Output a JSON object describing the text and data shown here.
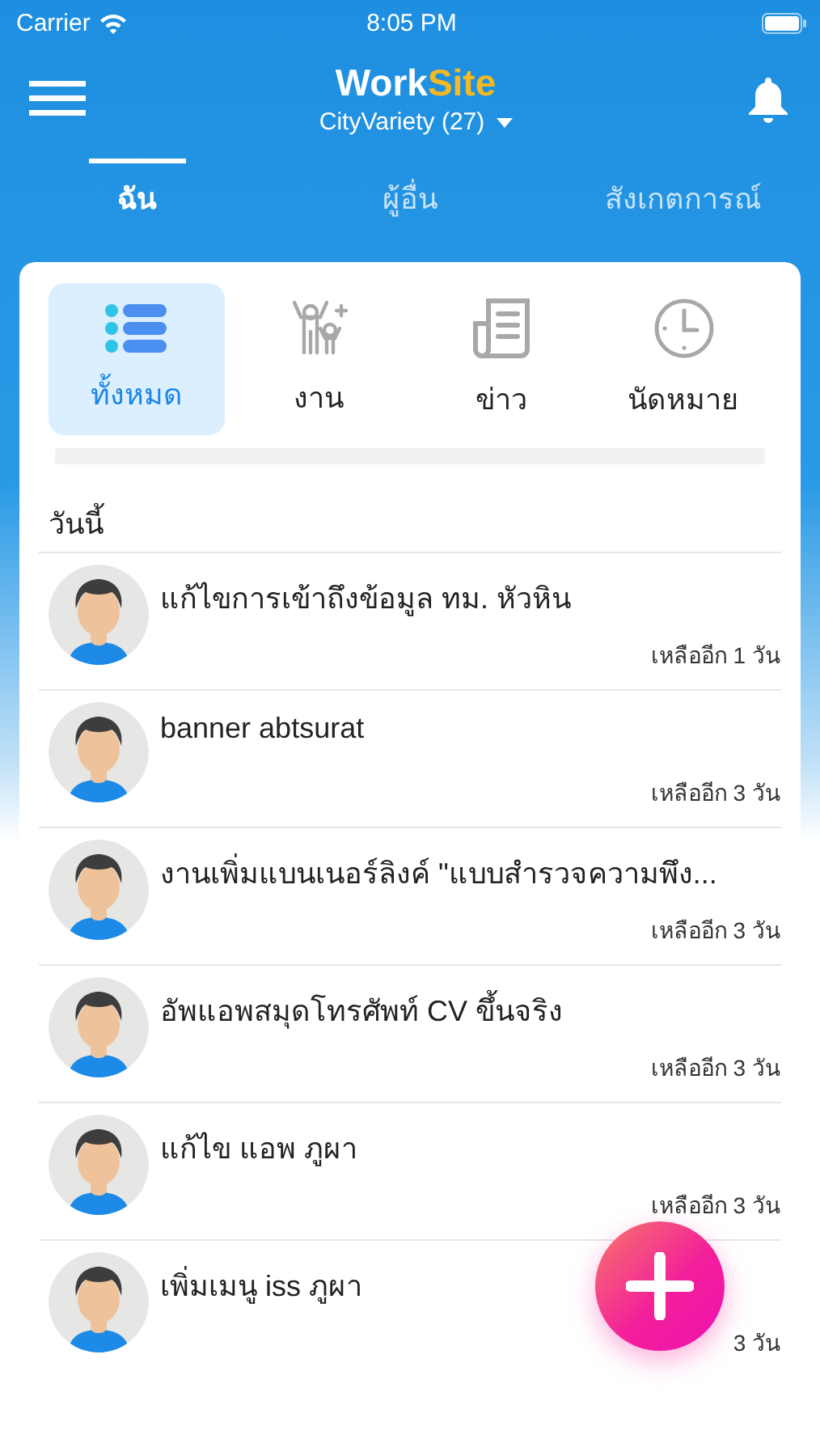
{
  "status_bar": {
    "carrier": "Carrier",
    "time": "8:05 PM"
  },
  "header": {
    "title_part1": "Work",
    "title_part2": "Site",
    "subtitle": "CityVariety (27)"
  },
  "tabs": [
    {
      "label": "ฉัน",
      "selected": true
    },
    {
      "label": "ผู้อื่น",
      "selected": false
    },
    {
      "label": "สังเกตการณ์",
      "selected": false
    }
  ],
  "categories": [
    {
      "label": "ทั้งหมด",
      "kind": "list",
      "selected": true
    },
    {
      "label": "งาน",
      "kind": "people",
      "selected": false
    },
    {
      "label": "ข่าว",
      "kind": "news",
      "selected": false
    },
    {
      "label": "นัดหมาย",
      "kind": "clock",
      "selected": false
    }
  ],
  "section_title": "วันนี้",
  "items": [
    {
      "title": "แก้ไขการเข้าถึงข้อมูล ทม. หัวหิน",
      "due": "เหลืออีก 1 วัน"
    },
    {
      "title": "banner abtsurat",
      "due": "เหลืออีก 3 วัน"
    },
    {
      "title": "งานเพิ่มแบนเนอร์ลิงค์ \"แบบสำรวจความพึง...",
      "due": "เหลืออีก 3 วัน"
    },
    {
      "title": "อัพแอพสมุดโทรศัพท์ CV ขึ้นจริง",
      "due": "เหลืออีก 3 วัน"
    },
    {
      "title": "แก้ไข แอพ ภูผา",
      "due": "เหลืออีก 3 วัน"
    },
    {
      "title": "เพิ่มเมนู iss ภูผา",
      "due": "3 วัน"
    }
  ]
}
